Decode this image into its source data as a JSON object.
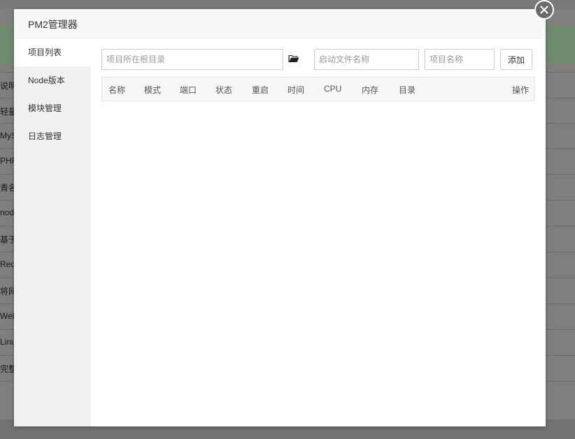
{
  "background": {
    "row_texts": [
      "说明",
      "轻量",
      "MyS",
      "PHP",
      "青名",
      "node",
      "基于",
      "Redi",
      "将网",
      "Web",
      "Linux",
      "完整"
    ]
  },
  "modal": {
    "title": "PM2管理器",
    "close_icon": "close-icon"
  },
  "sidebar": {
    "items": [
      {
        "label": "项目列表",
        "active": true
      },
      {
        "label": "Node版本",
        "active": false
      },
      {
        "label": "模块管理",
        "active": false
      },
      {
        "label": "日志管理",
        "active": false
      }
    ]
  },
  "form": {
    "root_dir_placeholder": "项目所在根目录",
    "folder_icon": "folder-open-icon",
    "startup_file_placeholder": "启动文件名称",
    "project_name_placeholder": "项目名称",
    "add_label": "添加"
  },
  "table": {
    "headers": [
      "名称",
      "模式",
      "端口",
      "状态",
      "重启",
      "时间",
      "CPU",
      "内存",
      "目录",
      "操作"
    ]
  }
}
